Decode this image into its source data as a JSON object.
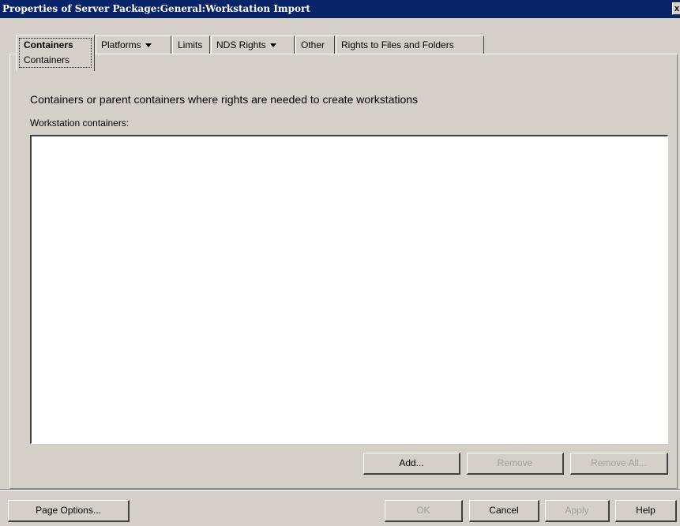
{
  "window": {
    "title": "Properties of Server Package:General:Workstation Import",
    "close_glyph": "x"
  },
  "tabs": {
    "containers": {
      "label": "Containers",
      "sublabel": "Containers"
    },
    "platforms": {
      "label": "Platforms"
    },
    "limits": {
      "label": "Limits"
    },
    "nds_rights": {
      "label": "NDS Rights"
    },
    "other": {
      "label": "Other"
    },
    "rights_files": {
      "label": "Rights to Files and Folders"
    }
  },
  "main": {
    "description": "Containers or parent containers where rights are needed to create workstations",
    "list_label": "Workstation containers:"
  },
  "list_buttons": {
    "add": "Add...",
    "remove": "Remove",
    "remove_all": "Remove All..."
  },
  "footer": {
    "page_options": "Page Options...",
    "ok": "OK",
    "cancel": "Cancel",
    "apply": "Apply",
    "help": "Help"
  }
}
